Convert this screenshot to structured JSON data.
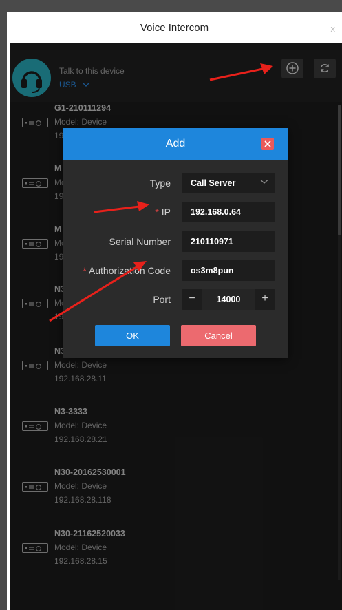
{
  "window": {
    "title": "Voice Intercom",
    "close_label": "x"
  },
  "header": {
    "talk_label": "Talk to this device",
    "audio_source": "USB",
    "add_icon": "plus-circle-icon",
    "refresh_icon": "refresh-icon"
  },
  "devices": [
    {
      "name": "G1-210111294",
      "model": "Model:  Device",
      "ip": "19"
    },
    {
      "name": "M",
      "model": "Mo",
      "ip": "19"
    },
    {
      "name": "M",
      "model": "Mo",
      "ip": "19"
    },
    {
      "name": "N3",
      "model": "Mo",
      "ip": "19"
    },
    {
      "name": "N3",
      "model": "Model:  Device",
      "ip": "192.168.28.11"
    },
    {
      "name": "N3-3333",
      "model": "Model:  Device",
      "ip": "192.168.28.21"
    },
    {
      "name": "N30-20162530001",
      "model": "Model:  Device",
      "ip": "192.168.28.118"
    },
    {
      "name": "N30-21162520033",
      "model": "Model:  Device",
      "ip": "192.168.28.15"
    }
  ],
  "dialog": {
    "title": "Add",
    "type_label": "Type",
    "type_value": "Call Server",
    "ip_label": "IP",
    "ip_value": "192.168.0.64",
    "serial_label": "Serial Number",
    "serial_value": "210110971",
    "auth_label": "Authorization Code",
    "auth_value": "os3m8pun",
    "port_label": "Port",
    "port_value": "14000",
    "minus": "−",
    "plus": "+",
    "required_mark": "*",
    "ok_label": "OK",
    "cancel_label": "Cancel"
  },
  "colors": {
    "accent": "#1e86dc",
    "danger": "#ec6a6f",
    "annotation_arrow": "#e8211b",
    "avatar": "#27a6b6"
  }
}
